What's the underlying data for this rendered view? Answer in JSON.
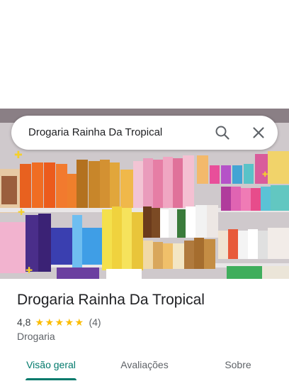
{
  "search": {
    "query": "Drogaria Rainha Da Tropical",
    "search_icon": "search-icon",
    "close_icon": "close-icon"
  },
  "place": {
    "name": "Drogaria Rainha Da Tropical",
    "rating": "4,8",
    "stars_filled": 5,
    "reviews": "(4)",
    "category": "Drogaria"
  },
  "tabs": [
    {
      "label": "Visão geral",
      "active": true
    },
    {
      "label": "Avaliações",
      "active": false
    },
    {
      "label": "Sobre",
      "active": false
    }
  ],
  "colors": {
    "accent": "#00796b",
    "star": "#fbbc04",
    "text_primary": "#202124",
    "text_secondary": "#5f6368"
  }
}
